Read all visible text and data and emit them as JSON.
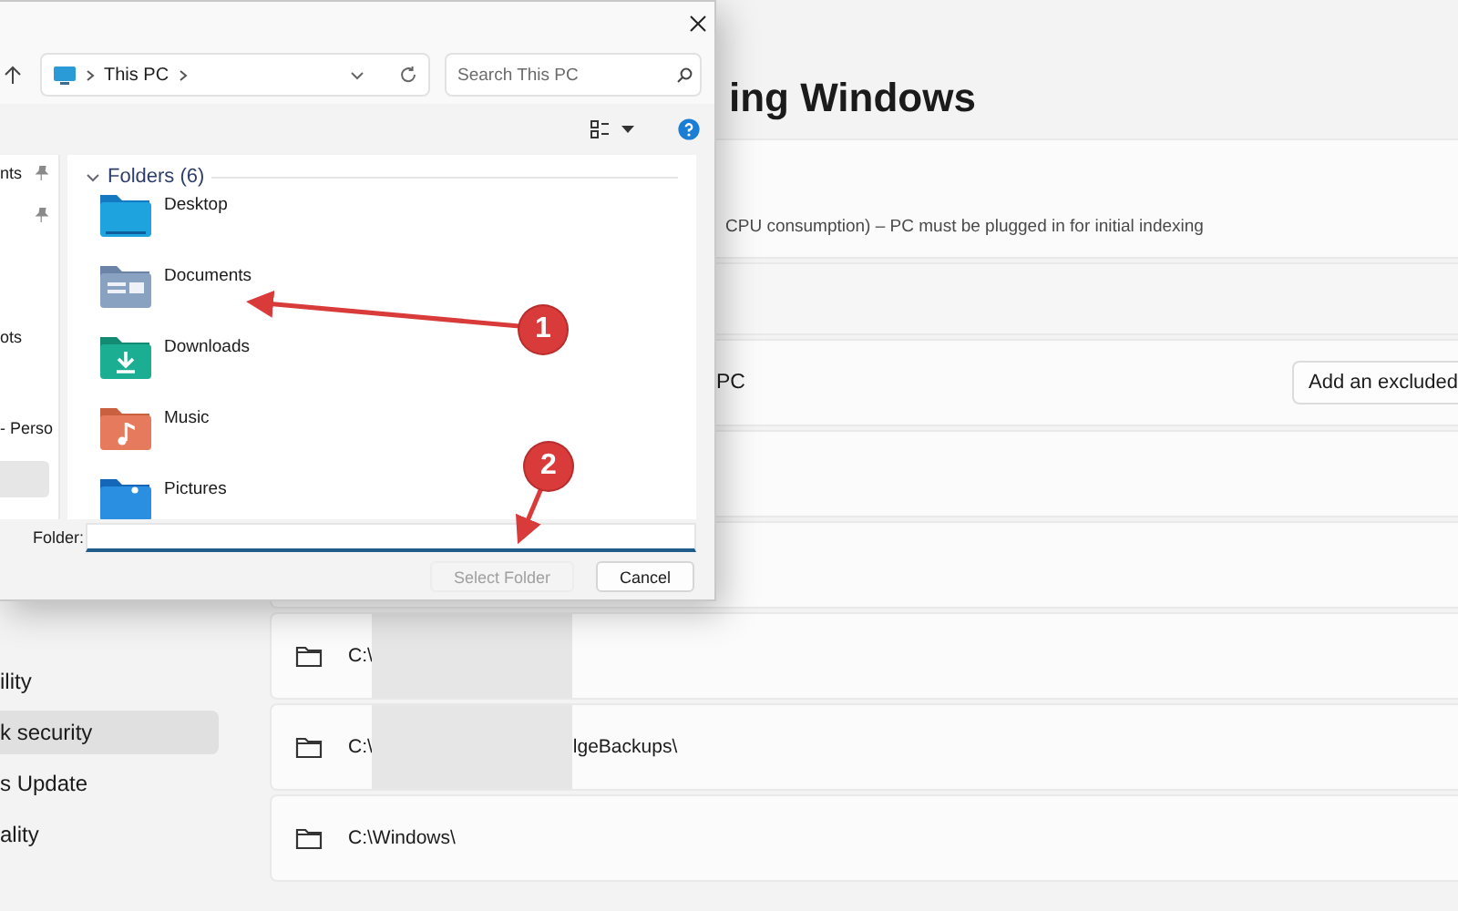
{
  "settings": {
    "title": "ing Windows",
    "indexing_note": "CPU consumption) – PC must be plugged in for initial indexing",
    "exclude_row": {
      "label": "PC",
      "button": "Add an excluded"
    },
    "excluded_folders": [
      {
        "path": "C:\\",
        "redacted": true
      },
      {
        "path": "C:\\",
        "suffix": "lgeBackups\\",
        "redacted": true
      },
      {
        "path": "C:\\Windows\\",
        "redacted": false
      }
    ],
    "nav": [
      {
        "label": "ility",
        "selected": false
      },
      {
        "label": "k security",
        "selected": true
      },
      {
        "label": "s Update",
        "selected": false
      },
      {
        "label": "ality",
        "selected": false
      }
    ]
  },
  "dialog": {
    "address": "This PC",
    "search": {
      "placeholder": "Search This PC"
    },
    "nav_items": [
      {
        "label": "nts",
        "pinned": true,
        "selected": false
      },
      {
        "pinned": true,
        "selected": false
      },
      {
        "label": "ots",
        "pinned": false,
        "selected": false
      },
      {
        "label": "- Perso",
        "pinned": false,
        "selected": false
      },
      {
        "pinned": false,
        "selected": true
      }
    ],
    "section": "Folders (6)",
    "folders": [
      {
        "name": "Desktop",
        "kind": "desktop"
      },
      {
        "name": "Documents",
        "kind": "documents"
      },
      {
        "name": "Downloads",
        "kind": "downloads"
      },
      {
        "name": "Music",
        "kind": "music"
      },
      {
        "name": "Pictures",
        "kind": "pictures"
      }
    ],
    "folder_field": {
      "label": "Folder:"
    },
    "buttons": [
      {
        "label": "Select Folder",
        "disabled": true
      },
      {
        "label": "Cancel",
        "disabled": false
      }
    ]
  },
  "annotations": [
    {
      "label": "1"
    },
    {
      "label": "2"
    }
  ]
}
